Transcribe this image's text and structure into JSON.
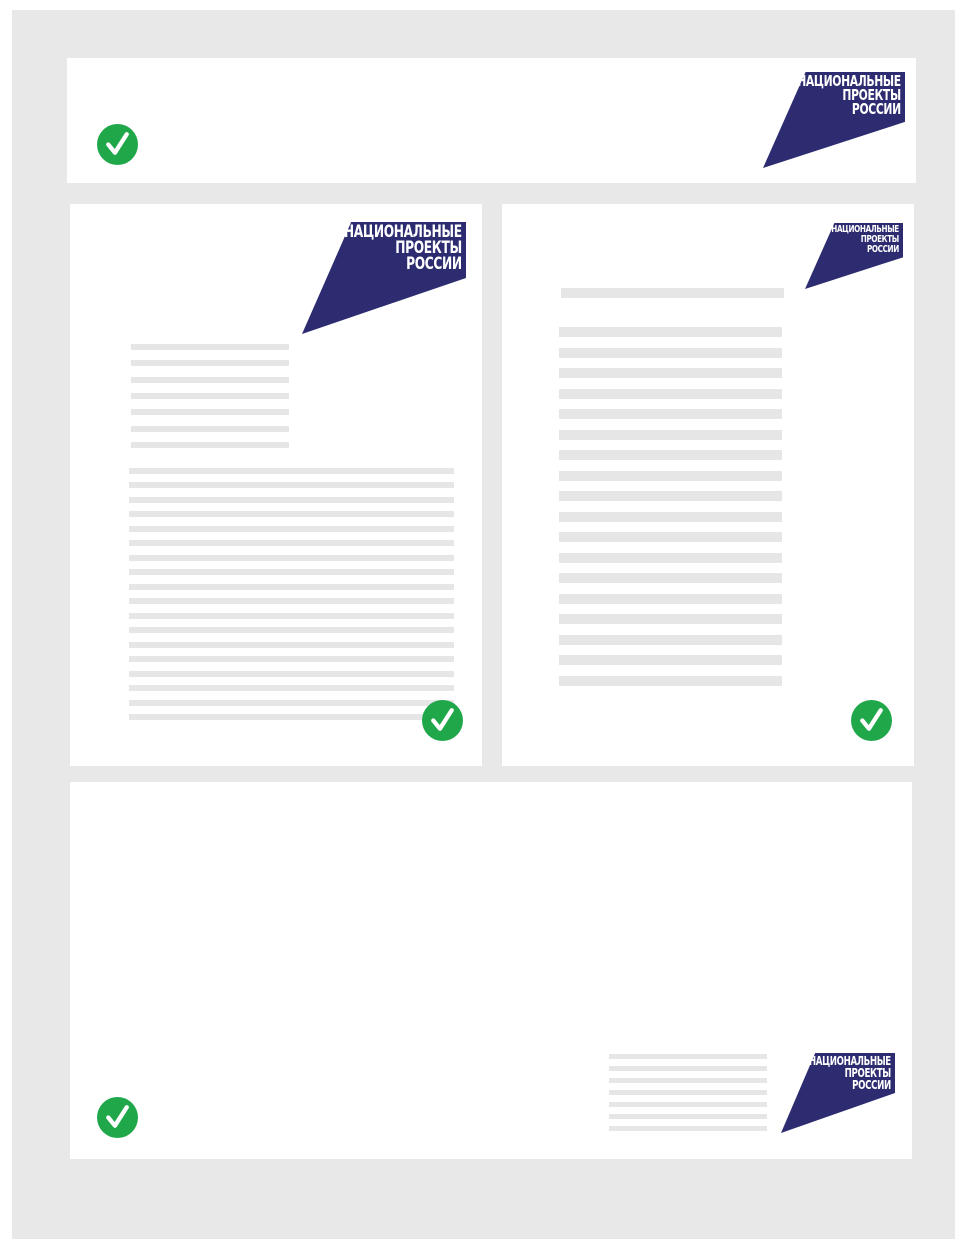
{
  "logo": {
    "line1": "НАЦИОНАЛЬНЫЕ",
    "line2": "ПРОЕКТЫ",
    "line3": "РОССИИ",
    "brand_color": "#2d2c70",
    "text_color": "#ffffff"
  },
  "check": {
    "icon": "checkmark-circle-icon",
    "color": "#1fa74a"
  },
  "placeholder_line_color": "#e6e6e6",
  "frame_color": "#e8e8e8"
}
